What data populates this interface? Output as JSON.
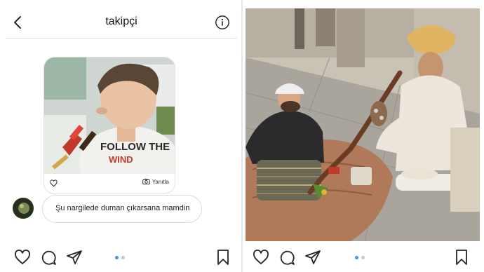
{
  "left_post": {
    "dm": {
      "title": "takipçi",
      "shared_post": {
        "reply_label": "Yanıtla"
      },
      "message": "Şu nargilede duman çıkarsana mamdin"
    },
    "carousel": {
      "active_index": 0,
      "count": 2
    }
  },
  "right_post": {
    "carousel": {
      "active_index": 0,
      "count": 2
    }
  },
  "colors": {
    "dot_active": "#3897f0",
    "dot_inactive": "#c7c7c7",
    "icon_stroke": "#262626"
  }
}
